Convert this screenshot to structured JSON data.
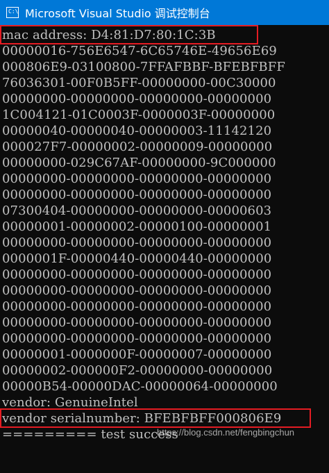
{
  "window": {
    "title": "Microsoft Visual Studio 调试控制台",
    "icon": "console-icon",
    "accent_color": "#0078d7"
  },
  "console": {
    "background": "#0c0c0c",
    "text_color": "#c0c0c0",
    "highlight_color": "#e51c23",
    "lines": [
      "mac address: D4:81:D7:80:1C:3B",
      "00000016-756E6547-6C65746E-49656E69",
      "000806E9-03100800-7FFAFBBF-BFEBFBFF",
      "76036301-00F0B5FF-00000000-00C30000",
      "00000000-00000000-00000000-00000000",
      "1C004121-01C0003F-0000003F-00000000",
      "00000040-00000040-00000003-11142120",
      "000027F7-00000002-00000009-00000000",
      "00000000-029C67AF-00000000-9C000000",
      "00000000-00000000-00000000-00000000",
      "00000000-00000000-00000000-00000000",
      "07300404-00000000-00000000-00000603",
      "00000001-00000002-00000100-00000001",
      "00000000-00000000-00000000-00000000",
      "0000001F-00000440-00000440-00000000",
      "00000000-00000000-00000000-00000000",
      "00000000-00000000-00000000-00000000",
      "00000000-00000000-00000000-00000000",
      "00000000-00000000-00000000-00000000",
      "00000000-00000000-00000000-00000000",
      "00000001-0000000F-00000007-00000000",
      "00000002-000000F2-00000000-00000000",
      "00000B54-00000DAC-00000064-00000000",
      "vendor: GenuineIntel",
      "vendor serialnumber: BFEBFBFF000806E9",
      "========= test success"
    ]
  },
  "watermark": "https://blog.csdn.net/fengbingchun"
}
